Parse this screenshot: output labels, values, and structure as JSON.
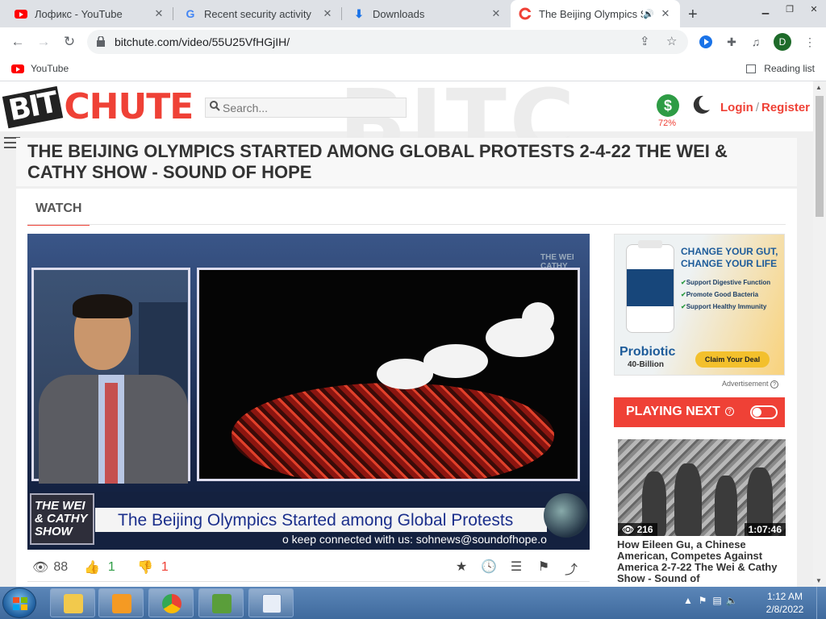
{
  "browser": {
    "tabs": [
      {
        "title": "Лофикс - YouTube",
        "icon": "youtube-icon"
      },
      {
        "title": "Recent security activity",
        "icon": "google-icon"
      },
      {
        "title": "Downloads",
        "icon": "download-icon"
      },
      {
        "title": "The Beijing Olympics S",
        "icon": "bitchute-icon",
        "active": true
      }
    ],
    "url": "bitchute.com/video/55U25VfHGjIH/",
    "profile_initial": "D",
    "bookmarks": [
      {
        "label": "YouTube"
      }
    ],
    "reading_list": "Reading list"
  },
  "site": {
    "logo_bit": "BIT",
    "logo_chute": "CHUTE",
    "watermark": "BITC",
    "search_placeholder": "Search...",
    "donate_symbol": "$",
    "donate_percent": "72%",
    "login": "Login",
    "slash": "/",
    "register": "Register"
  },
  "video": {
    "title": "THE BEIJING OLYMPICS STARTED AMONG GLOBAL PROTESTS 2-4-22 THE WEI & CATHY SHOW - SOUND OF HOPE",
    "tab_label": "WATCH",
    "show_logo": "THE WEI & CATHY SHOW",
    "caption": "The Beijing Olympics Started among Global Protests",
    "ticker": "o keep connected with us: sohnews@soundofhope.o",
    "show_watermark": "THE WEI CATHY SHOW",
    "views": "88",
    "likes": "1",
    "dislikes": "1"
  },
  "ad": {
    "headline_1": "CHANGE YOUR GUT,",
    "headline_2": "CHANGE YOUR LIFE",
    "bullets": [
      "Support Digestive Function",
      "Promote Good Bacteria",
      "Support Healthy Immunity"
    ],
    "brand": "Probiotic",
    "brand_sub": "40-Billion",
    "cta": "Claim Your Deal",
    "label": "Advertisement",
    "label_icon": "?"
  },
  "playing_next": {
    "label": "PLAYING NEXT",
    "help_icon": "?",
    "autoplay_on": false,
    "item": {
      "views": "216",
      "duration": "1:07:46",
      "title": "How Eileen Gu, a Chinese American, Competes Against America 2-7-22 The Wei & Cathy Show - Sound of"
    }
  },
  "taskbar": {
    "time": "1:12 AM",
    "date": "2/8/2022"
  },
  "colors": {
    "brand_red": "#ef4136",
    "donate_green": "#2e9c45",
    "taskbar_blue": "#3f6a9d"
  }
}
